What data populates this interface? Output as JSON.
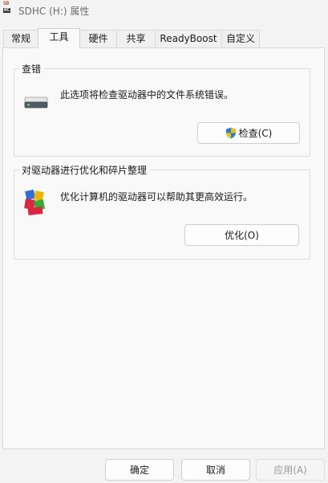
{
  "window": {
    "icon_text_top": "SD",
    "icon_text_bottom": "HC",
    "title": "SDHC (H:) 属性"
  },
  "tabs": [
    {
      "label": "常规",
      "active": false
    },
    {
      "label": "工具",
      "active": true
    },
    {
      "label": "硬件",
      "active": false
    },
    {
      "label": "共享",
      "active": false
    },
    {
      "label": "ReadyBoost",
      "active": false
    },
    {
      "label": "自定义",
      "active": false
    }
  ],
  "error_check": {
    "title": "查错",
    "description": "此选项将检查驱动器中的文件系统错误。",
    "button_label": "检查(C)",
    "icon": "drive-icon"
  },
  "optimize": {
    "title": "对驱动器进行优化和碎片整理",
    "description": "优化计算机的驱动器可以帮助其更高效运行。",
    "button_label": "优化(O)",
    "icon": "defrag-icon"
  },
  "footer": {
    "ok_label": "确定",
    "cancel_label": "取消",
    "apply_label": "应用(A)"
  },
  "colors": {
    "shield_blue": "#2a7ae2",
    "shield_yellow": "#f2c200",
    "defrag_red": "#d7263d",
    "defrag_green": "#3aa935",
    "defrag_blue": "#2f6fd6",
    "defrag_yellow": "#f0b400"
  }
}
